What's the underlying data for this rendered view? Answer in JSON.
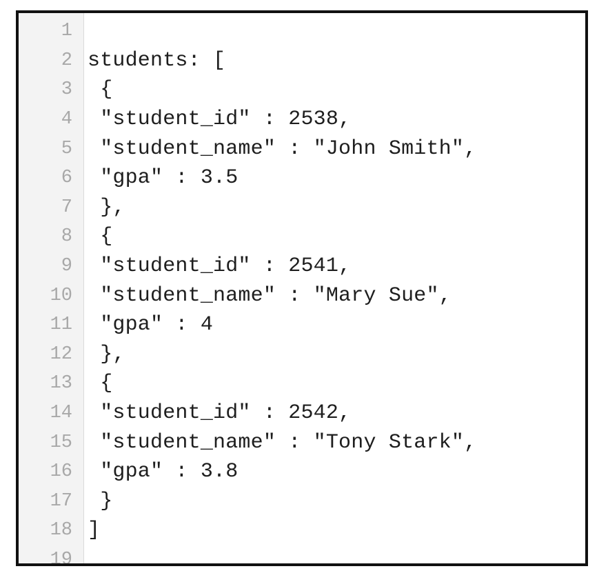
{
  "editor": {
    "lines": [
      {
        "number": "1",
        "text": ""
      },
      {
        "number": "2",
        "text": "students: ["
      },
      {
        "number": "3",
        "text": " {"
      },
      {
        "number": "4",
        "text": " \"student_id\" : 2538,"
      },
      {
        "number": "5",
        "text": " \"student_name\" : \"John Smith\","
      },
      {
        "number": "6",
        "text": " \"gpa\" : 3.5"
      },
      {
        "number": "7",
        "text": " },"
      },
      {
        "number": "8",
        "text": " {"
      },
      {
        "number": "9",
        "text": " \"student_id\" : 2541,"
      },
      {
        "number": "10",
        "text": " \"student_name\" : \"Mary Sue\","
      },
      {
        "number": "11",
        "text": " \"gpa\" : 4"
      },
      {
        "number": "12",
        "text": " },"
      },
      {
        "number": "13",
        "text": " {"
      },
      {
        "number": "14",
        "text": " \"student_id\" : 2542,"
      },
      {
        "number": "15",
        "text": " \"student_name\" : \"Tony Stark\","
      },
      {
        "number": "16",
        "text": " \"gpa\" : 3.8"
      },
      {
        "number": "17",
        "text": " }"
      },
      {
        "number": "18",
        "text": "]"
      },
      {
        "number": "19",
        "text": ""
      }
    ]
  }
}
